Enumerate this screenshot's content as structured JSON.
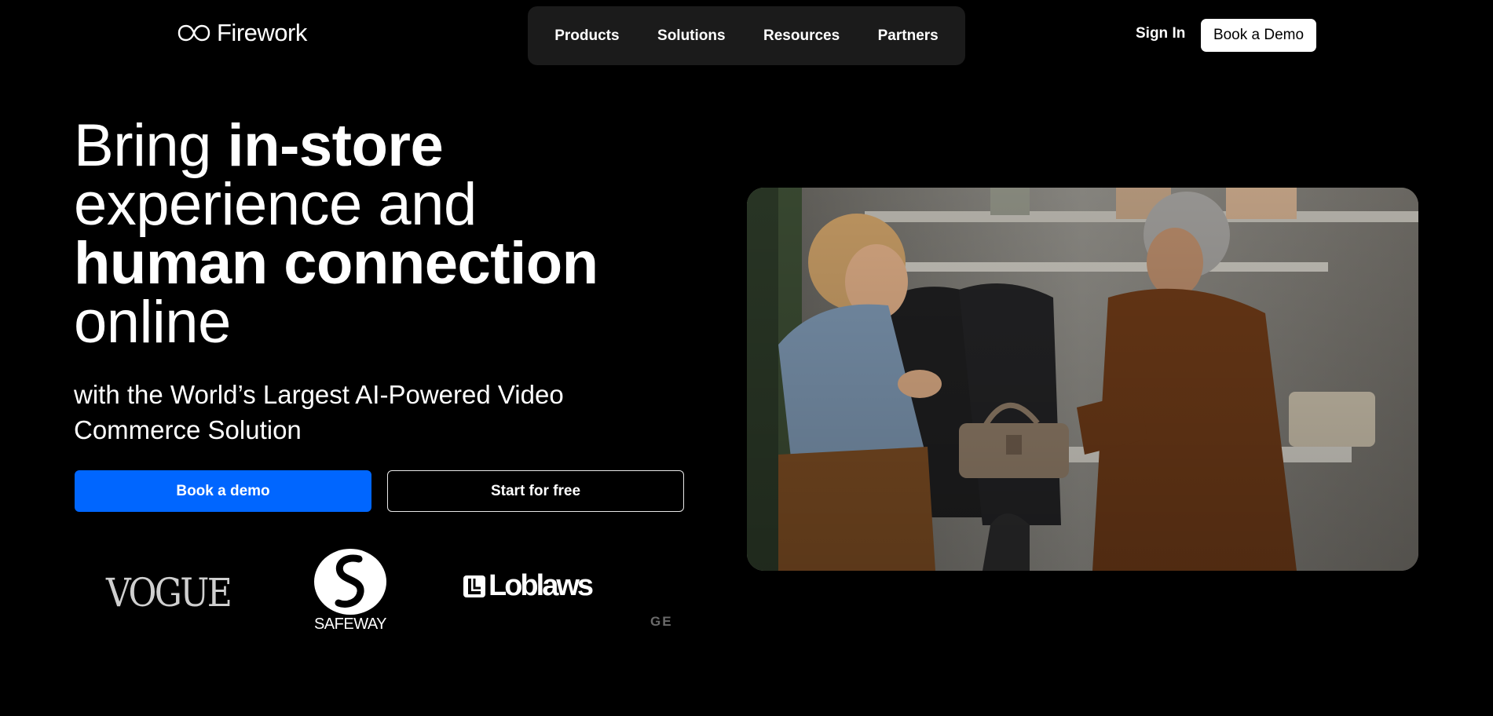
{
  "brand": {
    "name": "Firework",
    "logo_icon": "infinity-loop-icon"
  },
  "nav": {
    "items": [
      "Products",
      "Solutions",
      "Resources",
      "Partners"
    ]
  },
  "header": {
    "sign_in": "Sign In",
    "book_demo": "Book a Demo"
  },
  "hero": {
    "headline_parts": [
      "Bring ",
      "in-store",
      "experience and",
      "human connection",
      "online"
    ],
    "subhead": "with the World’s Largest AI-Powered Video Commerce Solution",
    "primary_cta": "Book a demo",
    "secondary_cta": "Start for free",
    "image_alt": "Store associate showing a handbag to a customer"
  },
  "logos": {
    "vogue": "VOGUE",
    "safeway": "SAFEWAY",
    "loblaws": "Loblaws",
    "partial": "GE"
  },
  "colors": {
    "background": "#000000",
    "nav_bg": "#1b1b1b",
    "primary": "#0066ff"
  }
}
